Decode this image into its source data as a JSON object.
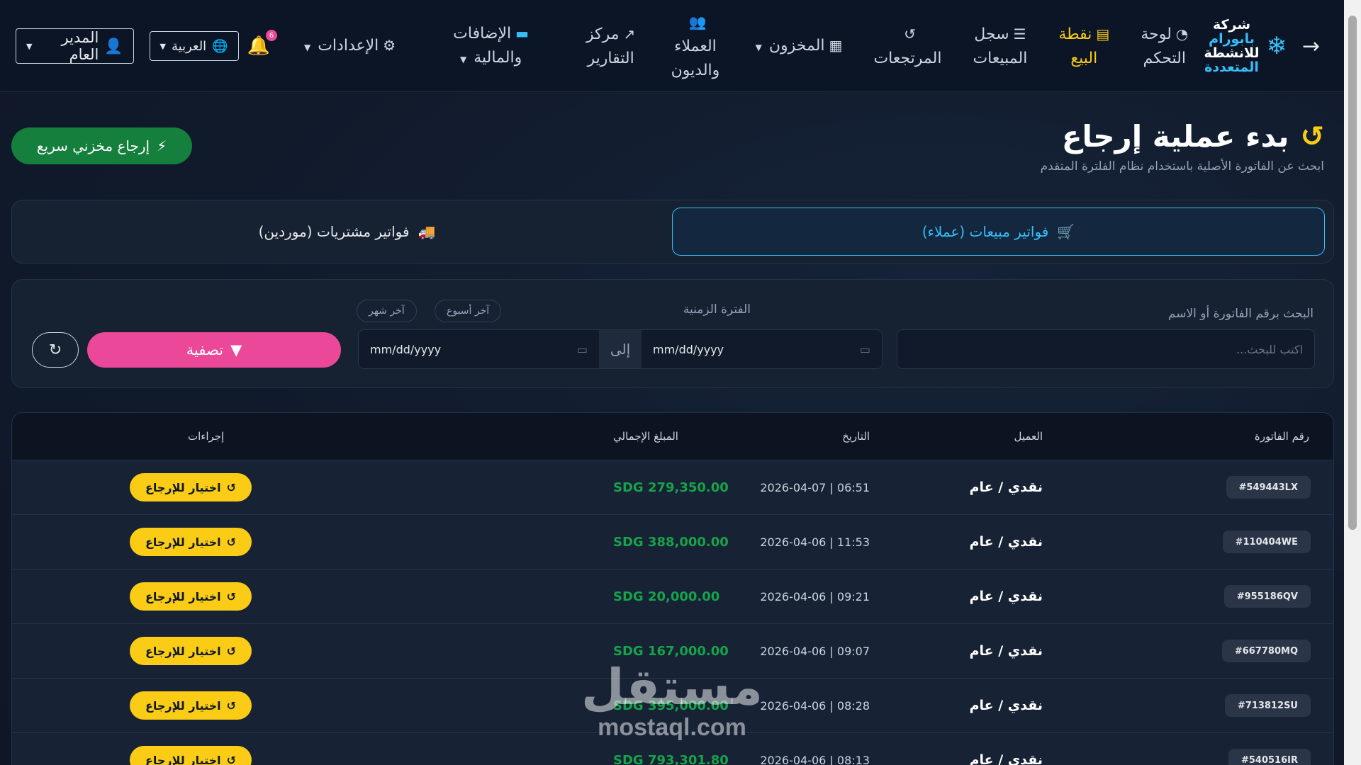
{
  "nav": {
    "brand_line1": "شركة",
    "brand_line2": "بابورام",
    "brand_line3": "للانشطة",
    "brand_line4": "المتعددة",
    "items": [
      {
        "line1": "لوحة",
        "line2": "التحكم"
      },
      {
        "line1": "نقطة",
        "line2": "البيع"
      },
      {
        "line1": "سجل",
        "line2": "المبيعات"
      },
      {
        "line1": "",
        "line2": "المرتجعات"
      },
      {
        "line1": "المخزون",
        "line2": ""
      },
      {
        "line1": "العملاء",
        "line2": "والديون"
      },
      {
        "line1": "مركز",
        "line2": "التقارير"
      },
      {
        "line1": "الإضافات والمالية",
        "line2": ""
      },
      {
        "line1": "الإعدادات",
        "line2": ""
      }
    ],
    "notifications": "6",
    "language": "العربية",
    "user": "المدير العام"
  },
  "page": {
    "title": "بدء عملية إرجاع",
    "subtitle": "ابحث عن الفاتورة الأصلية باستخدام نظام الفلترة المتقدم",
    "quick_return": "إرجاع مخزني سريع"
  },
  "tabs": {
    "sales": "فواتير مبيعات (عملاء)",
    "purchases": "فواتير مشتريات (موردين)"
  },
  "filter": {
    "search_label": "البحث برقم الفاتورة أو الاسم",
    "search_placeholder": "اكتب للبحث...",
    "period_label": "الفترة الزمنية",
    "date_from": "mm/dd/yyyy",
    "date_to": "mm/dd/yyyy",
    "to_label": "إلى",
    "last_week": "آخر أسبوع",
    "last_month": "آخر شهر",
    "filter_button": "تصفية"
  },
  "table": {
    "headers": {
      "invoice": "رقم الفاتورة",
      "customer": "العميل",
      "date": "التاريخ",
      "total": "المبلغ الإجمالي",
      "actions": "إجراءات"
    },
    "action_label": "اختيار للإرجاع",
    "rows": [
      {
        "invoice": "#549443LX",
        "customer": "نقدي / عام",
        "date": "2026-04-07 | 06:51",
        "total": "SDG 279,350.00"
      },
      {
        "invoice": "#110404WE",
        "customer": "نقدي / عام",
        "date": "2026-04-06 | 11:53",
        "total": "SDG 388,000.00"
      },
      {
        "invoice": "#955186QV",
        "customer": "نقدي / عام",
        "date": "2026-04-06 | 09:21",
        "total": "SDG 20,000.00"
      },
      {
        "invoice": "#667780MQ",
        "customer": "نقدي / عام",
        "date": "2026-04-06 | 09:07",
        "total": "SDG 167,000.00"
      },
      {
        "invoice": "#713812SU",
        "customer": "نقدي / عام",
        "date": "2026-04-06 | 08:28",
        "total": "SDG 395,000.00"
      },
      {
        "invoice": "#540516IR",
        "customer": "نقدي / عام",
        "date": "2026-04-06 | 08:13",
        "total": "SDG 793,301.80"
      }
    ]
  },
  "watermark": {
    "arabic": "مستقل",
    "latin": "mostaql.com"
  },
  "colors": {
    "accent": "#38bdf8",
    "active": "#facc15",
    "danger": "#ec4899",
    "success": "#16a34a"
  }
}
